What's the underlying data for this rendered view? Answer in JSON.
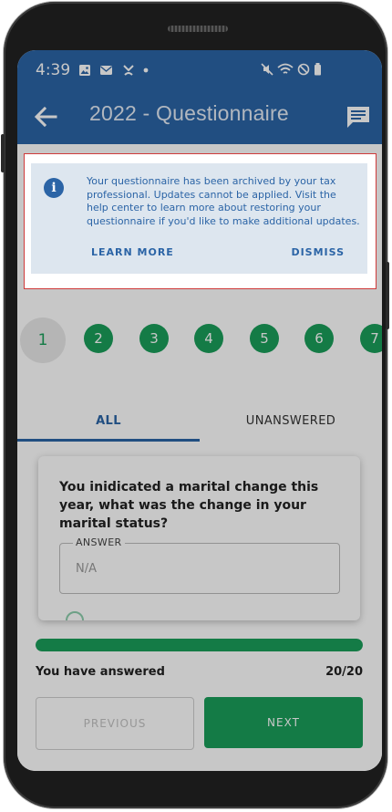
{
  "status_bar": {
    "time": "4:39",
    "left_icons": [
      "image-icon",
      "mail-icon",
      "missed-call-icon",
      "dot-icon"
    ],
    "right_icons": [
      "mute-icon",
      "wifi-icon",
      "do-not-disturb-icon",
      "battery-icon"
    ]
  },
  "app_bar": {
    "title": "2022 - Questionnaire",
    "back_icon": "arrow-left-icon",
    "action_icon": "chat-icon"
  },
  "banner": {
    "icon": "info-icon",
    "message": "Your questionnaire has been archived by your tax professional. Updates cannot be applied. Visit the help center to learn more about restoring your questionnaire if you'd like to make additional updates.",
    "learn_more_label": "LEARN MORE",
    "dismiss_label": "DISMISS",
    "highlight_color": "#cf3a3a"
  },
  "steps": [
    "1",
    "2",
    "3",
    "4",
    "5",
    "6",
    "7"
  ],
  "current_step": "1",
  "tabs": {
    "all": "ALL",
    "unanswered": "UNANSWERED"
  },
  "question": {
    "text": "You inidicated a marital change this year, what was the change in your marital status?",
    "answer_label": "ANSWER",
    "answer_value": "N/A"
  },
  "progress": {
    "label": "You have answered",
    "count": "20/20",
    "fraction": 1.0
  },
  "buttons": {
    "previous": "PREVIOUS",
    "next": "NEXT"
  },
  "colors": {
    "primary": "#2b64a6",
    "accent_green": "#1a9e5a"
  }
}
